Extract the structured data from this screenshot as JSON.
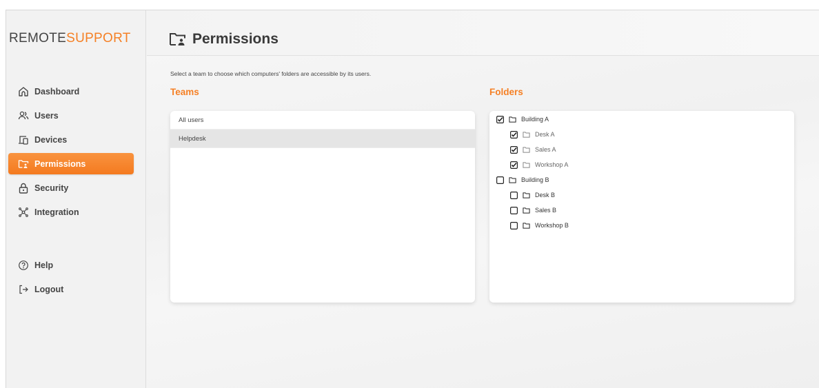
{
  "brand": {
    "logo_part1": "REMOTE",
    "logo_part2": "SUPPORT",
    "accent": "#f58025"
  },
  "nav": {
    "items": [
      {
        "label": "Dashboard",
        "icon": "home-icon"
      },
      {
        "label": "Users",
        "icon": "users-icon"
      },
      {
        "label": "Devices",
        "icon": "devices-icon"
      },
      {
        "label": "Permissions",
        "icon": "folder-permissions-icon",
        "active": true
      },
      {
        "label": "Security",
        "icon": "lock-icon"
      },
      {
        "label": "Integration",
        "icon": "integration-icon"
      }
    ],
    "bottom": [
      {
        "label": "Help",
        "icon": "help-icon"
      },
      {
        "label": "Logout",
        "icon": "logout-icon"
      }
    ]
  },
  "page": {
    "title": "Permissions",
    "instructions": "Select a team to choose which computers' folders are accessible by its users."
  },
  "teams": {
    "heading": "Teams",
    "items": [
      {
        "label": "All users",
        "selected": false
      },
      {
        "label": "Helpdesk",
        "selected": true
      }
    ]
  },
  "folders": {
    "heading": "Folders",
    "tree": [
      {
        "label": "Building A",
        "checked": true,
        "level": 0
      },
      {
        "label": "Desk A",
        "checked": true,
        "level": 1
      },
      {
        "label": "Sales A",
        "checked": true,
        "level": 1
      },
      {
        "label": "Workshop A",
        "checked": true,
        "level": 1
      },
      {
        "label": "Building B",
        "checked": false,
        "level": 0
      },
      {
        "label": "Desk B",
        "checked": false,
        "level": 1
      },
      {
        "label": "Sales B",
        "checked": false,
        "level": 1
      },
      {
        "label": "Workshop B",
        "checked": false,
        "level": 1
      }
    ]
  }
}
